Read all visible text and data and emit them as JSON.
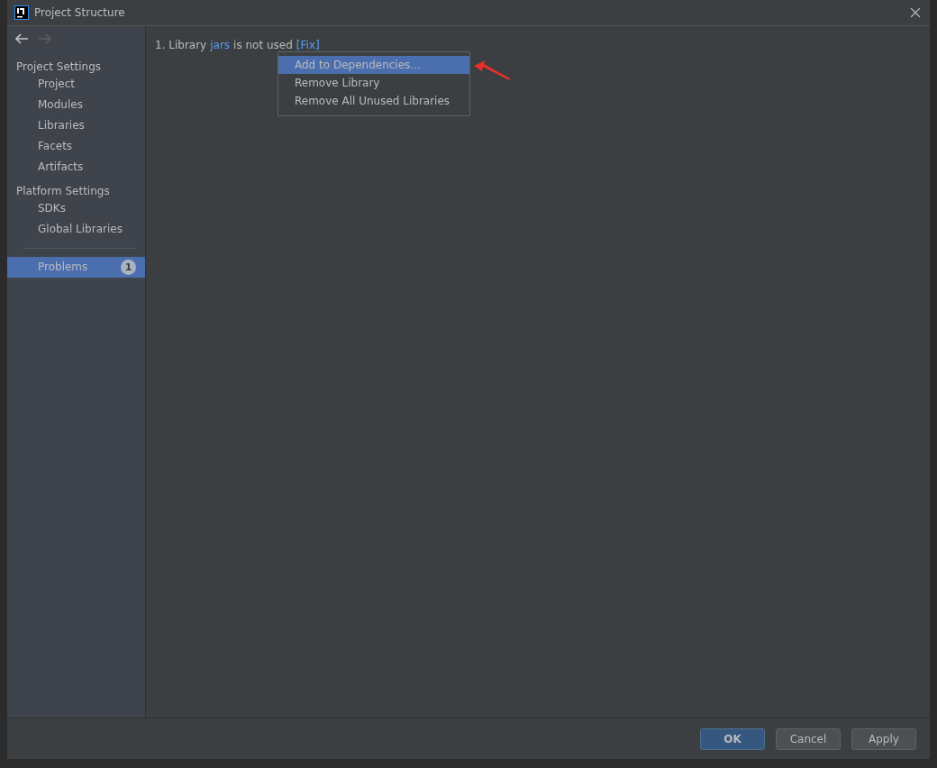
{
  "window": {
    "title": "Project Structure"
  },
  "sidebar": {
    "items": [
      {
        "kind": "header",
        "label": "Project Settings"
      },
      {
        "kind": "item",
        "label": "Project",
        "selected": false
      },
      {
        "kind": "item",
        "label": "Modules",
        "selected": false
      },
      {
        "kind": "item",
        "label": "Libraries",
        "selected": false
      },
      {
        "kind": "item",
        "label": "Facets",
        "selected": false
      },
      {
        "kind": "item",
        "label": "Artifacts",
        "selected": false
      },
      {
        "kind": "header",
        "label": "Platform Settings"
      },
      {
        "kind": "item",
        "label": "SDKs",
        "selected": false
      },
      {
        "kind": "item",
        "label": "Global Libraries",
        "selected": false
      },
      {
        "kind": "separator"
      },
      {
        "kind": "item",
        "label": "Problems",
        "selected": true,
        "badge": "1"
      }
    ]
  },
  "problem": {
    "number": "1.",
    "before": "Library",
    "link": "jars",
    "after": "is not used",
    "fix": "[Fix]"
  },
  "menu": {
    "items": [
      {
        "label": "Add to Dependencies...",
        "selected": true
      },
      {
        "label": "Remove Library",
        "selected": false
      },
      {
        "label": "Remove All Unused Libraries",
        "selected": false
      }
    ]
  },
  "buttons": [
    {
      "label": "OK",
      "kind": "default"
    },
    {
      "label": "Cancel",
      "kind": "normal"
    },
    {
      "label": "Apply",
      "kind": "normal"
    }
  ]
}
